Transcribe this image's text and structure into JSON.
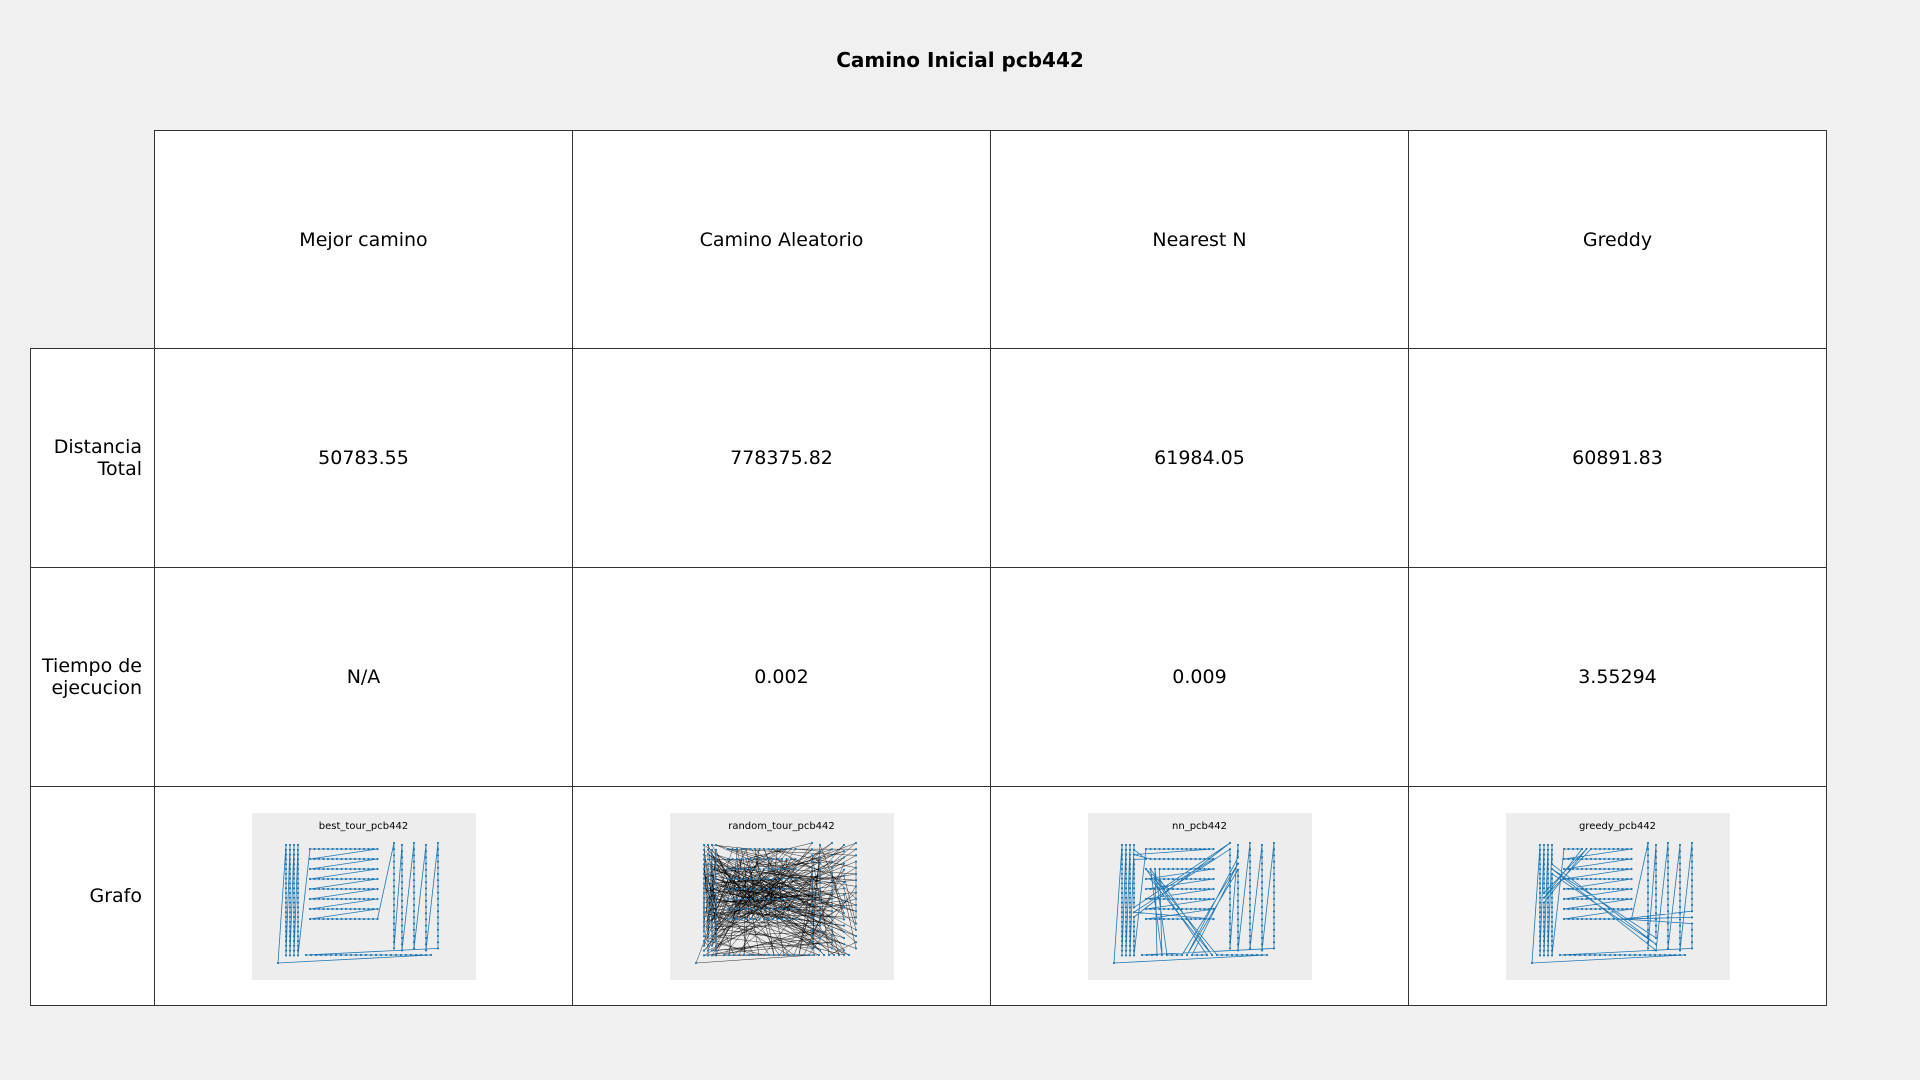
{
  "chart_data": {
    "type": "table",
    "title": "Camino Inicial pcb442",
    "columns": [
      "Mejor camino",
      "Camino Aleatorio",
      "Nearest N",
      "Greddy"
    ],
    "rows": [
      {
        "label": "Distancia\nTotal",
        "values": [
          "50783.55",
          "778375.82",
          "61984.05",
          "60891.83"
        ]
      },
      {
        "label": "Tiempo de\nejecucion",
        "values": [
          "N/A",
          "0.002",
          "0.009",
          "3.55294"
        ]
      },
      {
        "label": "Grafo",
        "graph_titles": [
          "best_tour_pcb442",
          "random_tour_pcb442",
          "nn_pcb442",
          "greedy_pcb442"
        ]
      }
    ],
    "graph_colors": {
      "nodes": "#1f77b4",
      "edges": "#000000"
    }
  }
}
